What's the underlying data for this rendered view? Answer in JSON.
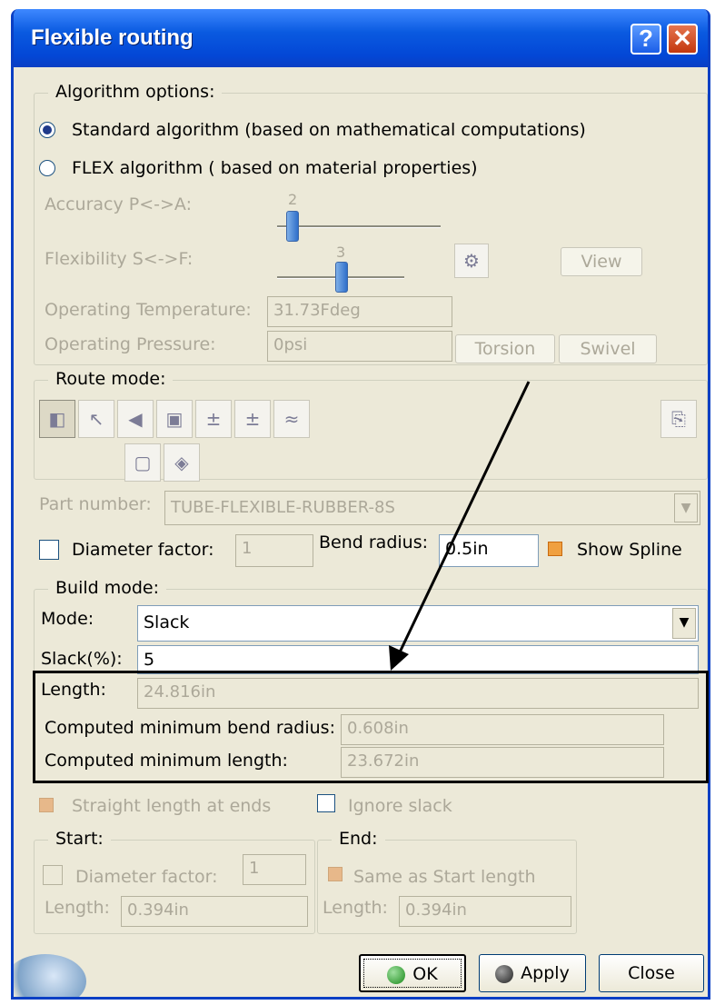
{
  "window": {
    "title": "Flexible routing",
    "help": "?",
    "close": "✕"
  },
  "algorithm": {
    "legend": "Algorithm options:",
    "standard": "Standard algorithm (based on mathematical computations)",
    "flex": "FLEX algorithm ( based on material properties)",
    "accuracy_label": "Accuracy P<->A:",
    "accuracy_value": "2",
    "accuracy_level": 2,
    "flexibility_label": "Flexibility S<->F:",
    "flexibility_value": "3",
    "flexibility_level": 3,
    "view": "View",
    "temp_label": "Operating Temperature:",
    "temp_value": "31.73Fdeg",
    "pressure_label": "Operating Pressure:",
    "pressure_value": "0psi",
    "torsion": "Torsion",
    "swivel": "Swivel"
  },
  "route": {
    "legend": "Route mode:",
    "part_label": "Part number:",
    "part_value": "TUBE-FLEXIBLE-RUBBER-8S",
    "diameter_label": "Diameter factor:",
    "diameter_value": "1",
    "bend_label": "Bend radius:",
    "bend_value": "0.5in",
    "spline_label": "Show Spline"
  },
  "build": {
    "legend": "Build mode:",
    "mode_label": "Mode:",
    "mode_value": "Slack",
    "slack_label": "Slack(%):",
    "slack_value": "5",
    "length_label": "Length:",
    "length_value": "24.816in",
    "cmbr_label": "Computed minimum bend radius:",
    "cmbr_value": "0.608in",
    "cml_label": "Computed minimum length:",
    "cml_value": "23.672in"
  },
  "ends": {
    "straight": "Straight length at ends",
    "ignore": "Ignore slack",
    "start_legend": "Start:",
    "end_legend": "End:",
    "diam_label": "Diameter factor:",
    "diam_value": "1",
    "same_label": "Same as Start length",
    "start_len_label": "Length:",
    "start_len_value": "0.394in",
    "end_len_label": "Length:",
    "end_len_value": "0.394in"
  },
  "footer": {
    "ok": "OK",
    "apply": "Apply",
    "close": "Close"
  }
}
